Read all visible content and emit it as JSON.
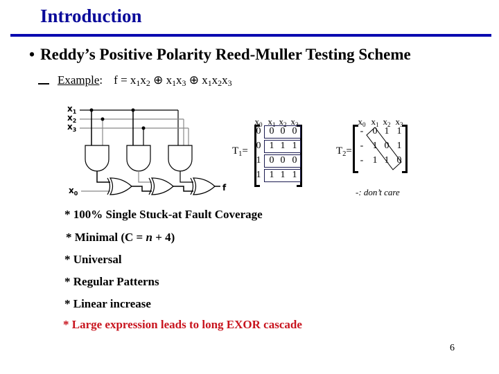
{
  "slide": {
    "title": "Introduction",
    "bullet": "Reddy’s Positive Polarity Reed-Muller Testing Scheme",
    "example_label": "Example",
    "example_colon": ":",
    "function": {
      "lhs": "f = ",
      "terms": [
        {
          "vars": [
            [
              "x",
              "1"
            ],
            [
              "x",
              "2"
            ]
          ]
        },
        {
          "vars": [
            [
              "x",
              "1"
            ],
            [
              "x",
              "3"
            ]
          ]
        },
        {
          "vars": [
            [
              "x",
              "1"
            ],
            [
              "x",
              "2"
            ],
            [
              "x",
              "3"
            ]
          ]
        }
      ],
      "operator": "⊕"
    },
    "page_number": "6"
  },
  "circuit": {
    "inputs": [
      "x1",
      "x2",
      "x3"
    ],
    "input_labels": [
      {
        "v": "x",
        "s": "1"
      },
      {
        "v": "x",
        "s": "2"
      },
      {
        "v": "x",
        "s": "3"
      }
    ],
    "x0_label": {
      "v": "x",
      "s": "0"
    },
    "output_label": "f",
    "and_gates": [
      [
        "x1",
        "x2"
      ],
      [
        "x1",
        "x3"
      ],
      [
        "x1",
        "x2",
        "x3"
      ]
    ],
    "xor_cascade": 3
  },
  "T1": {
    "label_main": "T",
    "label_sub": "1",
    "label_eq": "=",
    "headers": [
      {
        "v": "x",
        "s": "0"
      },
      {
        "v": "x",
        "s": "1"
      },
      {
        "v": "x",
        "s": "2"
      },
      {
        "v": "x",
        "s": "3"
      }
    ],
    "rows": [
      [
        "0",
        "0",
        "0",
        "0"
      ],
      [
        "0",
        "1",
        "1",
        "1"
      ],
      [
        "1",
        "0",
        "0",
        "0"
      ],
      [
        "1",
        "1",
        "1",
        "1"
      ]
    ]
  },
  "T2": {
    "label_main": "T",
    "label_sub": "2",
    "label_eq": "=",
    "headers": [
      {
        "v": "x",
        "s": "0"
      },
      {
        "v": "x",
        "s": "1"
      },
      {
        "v": "x",
        "s": "2"
      },
      {
        "v": "x",
        "s": "3"
      }
    ],
    "rows": [
      [
        "-",
        "0",
        "1",
        "1"
      ],
      [
        "-",
        "1",
        "0",
        "1"
      ],
      [
        "-",
        "1",
        "1",
        "0"
      ]
    ],
    "note": "-: don’t care"
  },
  "features": [
    {
      "text": "* 100% Single Stuck-at Fault Coverage",
      "color": "#000000"
    },
    {
      "text_pre": "* Minimal (C = ",
      "text_italic": "n",
      "text_post": " + 4)",
      "color": "#000000"
    },
    {
      "text": "* Universal",
      "color": "#000000"
    },
    {
      "text": "* Regular Patterns",
      "color": "#000000"
    },
    {
      "text": "* Linear increase",
      "color": "#000000"
    },
    {
      "text": "* Large expression leads to long EXOR cascade",
      "color": "#c8141e"
    }
  ],
  "colors": {
    "title": "#0a0a9a",
    "rule": "#0a0ab0",
    "highlight": "#c8141e"
  }
}
